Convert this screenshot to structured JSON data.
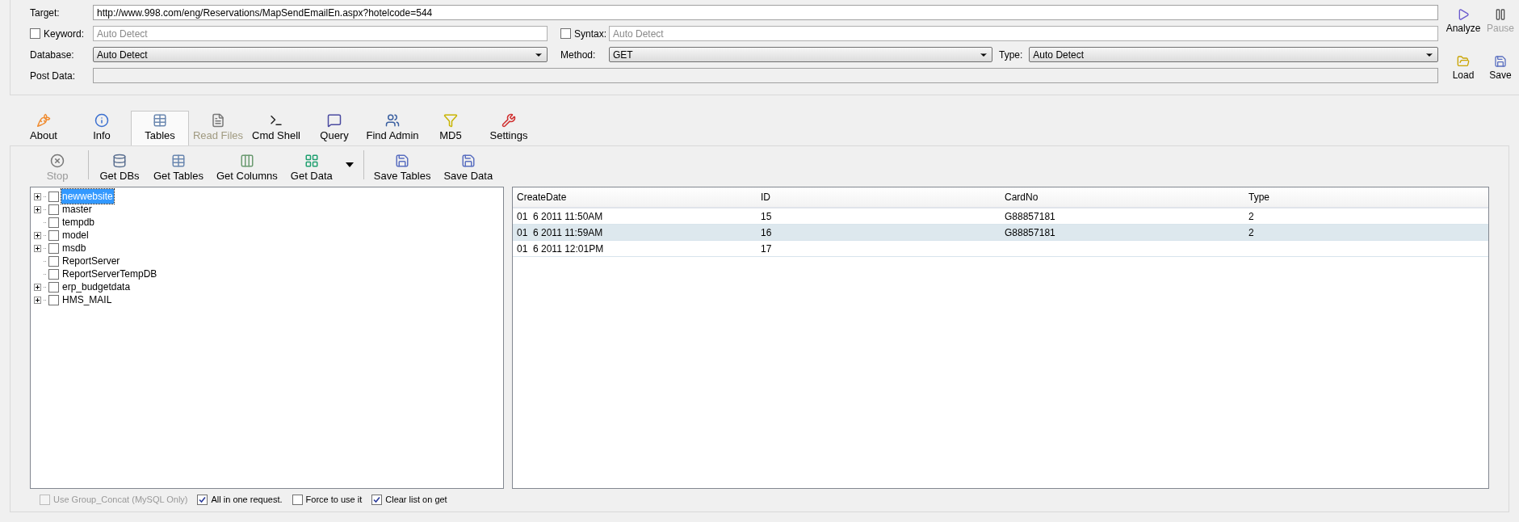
{
  "form": {
    "target": {
      "label": "Target:",
      "value": "http://www.998.com/eng/Reservations/MapSendEmailEn.aspx?hotelcode=544"
    },
    "keyword": {
      "label": "Keyword:",
      "checked": false,
      "placeholder": "Auto Detect"
    },
    "syntax": {
      "label": "Syntax:",
      "checked": false,
      "placeholder": "Auto Detect"
    },
    "database": {
      "label": "Database:",
      "value": "Auto Detect"
    },
    "method": {
      "label": "Method:",
      "value": "GET"
    },
    "type": {
      "label": "Type:",
      "value": "Auto Detect"
    },
    "post_data": {
      "label": "Post Data:"
    }
  },
  "actions": [
    {
      "label": "Analyze",
      "kind": "play",
      "disabled": false
    },
    {
      "label": "Pause",
      "kind": "pause",
      "disabled": true
    },
    {
      "label": "Load",
      "kind": "folder",
      "disabled": false
    },
    {
      "label": "Save",
      "kind": "save",
      "disabled": false
    }
  ],
  "tabs": [
    {
      "label": "About",
      "kind": "about",
      "selected": false,
      "disabled": false
    },
    {
      "label": "Info",
      "kind": "info",
      "selected": false,
      "disabled": false
    },
    {
      "label": "Tables",
      "kind": "tables",
      "selected": true,
      "disabled": false
    },
    {
      "label": "Read Files",
      "kind": "file",
      "selected": false,
      "disabled": true
    },
    {
      "label": "Cmd Shell",
      "kind": "shell",
      "selected": false,
      "disabled": false
    },
    {
      "label": "Query",
      "kind": "query",
      "selected": false,
      "disabled": false
    },
    {
      "label": "Find Admin",
      "kind": "admin",
      "selected": false,
      "disabled": false
    },
    {
      "label": "MD5",
      "kind": "md5",
      "selected": false,
      "disabled": false
    },
    {
      "label": "Settings",
      "kind": "settings",
      "selected": false,
      "disabled": false
    }
  ],
  "toolbar": [
    {
      "label": "Stop",
      "kind": "stop",
      "disabled": true
    },
    {
      "label": "Get DBs",
      "kind": "dbs",
      "disabled": false
    },
    {
      "label": "Get Tables",
      "kind": "tables",
      "disabled": false
    },
    {
      "label": "Get Columns",
      "kind": "columns",
      "disabled": false
    },
    {
      "label": "Get Data",
      "kind": "data",
      "disabled": false
    },
    {
      "label": "Save Tables",
      "kind": "save",
      "disabled": false
    },
    {
      "label": "Save Data",
      "kind": "save",
      "disabled": false
    }
  ],
  "tree": [
    {
      "label": "newwebsite",
      "expandable": true,
      "checked": false,
      "selected": true
    },
    {
      "label": "master",
      "expandable": true,
      "checked": false,
      "selected": false
    },
    {
      "label": "tempdb",
      "expandable": false,
      "checked": false,
      "selected": false
    },
    {
      "label": "model",
      "expandable": true,
      "checked": false,
      "selected": false
    },
    {
      "label": "msdb",
      "expandable": true,
      "checked": false,
      "selected": false
    },
    {
      "label": "ReportServer",
      "expandable": false,
      "checked": false,
      "selected": false
    },
    {
      "label": "ReportServerTempDB",
      "expandable": false,
      "checked": false,
      "selected": false
    },
    {
      "label": "erp_budgetdata",
      "expandable": true,
      "checked": false,
      "selected": false
    },
    {
      "label": "HMS_MAIL",
      "expandable": true,
      "checked": false,
      "selected": false
    }
  ],
  "table": {
    "columns": [
      "CreateDate",
      "ID",
      "CardNo",
      "Type"
    ],
    "rows": [
      {
        "cells": [
          "01  6 2011 11:50AM",
          "15",
          "G88857181",
          "2"
        ],
        "selected": false
      },
      {
        "cells": [
          "01  6 2011 11:59AM",
          "16",
          "G88857181",
          "2"
        ],
        "selected": true
      },
      {
        "cells": [
          "01  6 2011 12:01PM",
          "17",
          "",
          ""
        ],
        "selected": false
      }
    ]
  },
  "options": [
    {
      "label": "Use Group_Concat (MySQL Only)",
      "checked": false,
      "disabled": true
    },
    {
      "label": "All in one request.",
      "checked": true,
      "disabled": false
    },
    {
      "label": "Force to use it",
      "checked": false,
      "disabled": false
    },
    {
      "label": "Clear list on get",
      "checked": true,
      "disabled": false
    }
  ]
}
